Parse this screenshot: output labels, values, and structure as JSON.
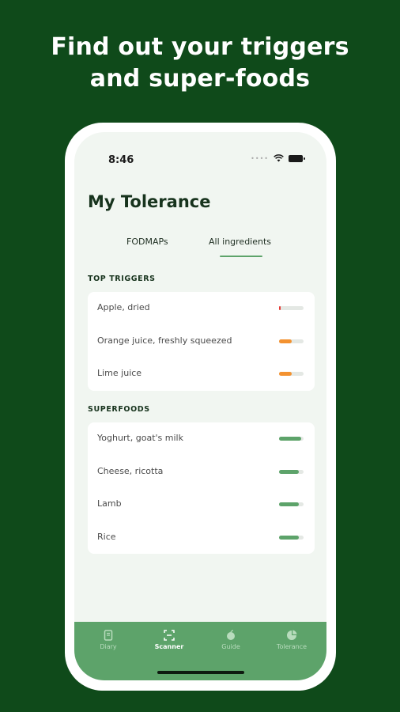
{
  "headline": {
    "line1": "Find out your triggers",
    "line2": "and super-foods"
  },
  "status_bar": {
    "time": "8:46"
  },
  "page": {
    "title": "My Tolerance"
  },
  "tabs": [
    {
      "label": "FODMAPs",
      "active": false
    },
    {
      "label": "All ingredients",
      "active": true
    }
  ],
  "top_triggers": {
    "label": "TOP TRIGGERS",
    "items": [
      {
        "name": "Apple, dried",
        "level": 0.05,
        "color": "#e53935"
      },
      {
        "name": "Orange juice, freshly squeezed",
        "level": 0.5,
        "color": "#f39230"
      },
      {
        "name": "Lime juice",
        "level": 0.5,
        "color": "#f39230"
      }
    ]
  },
  "superfoods": {
    "label": "SUPERFOODS",
    "items": [
      {
        "name": "Yoghurt, goat's milk",
        "level": 0.9,
        "color": "#5da36a"
      },
      {
        "name": "Cheese, ricotta",
        "level": 0.8,
        "color": "#5da36a"
      },
      {
        "name": "Lamb",
        "level": 0.8,
        "color": "#5da36a"
      },
      {
        "name": "Rice",
        "level": 0.8,
        "color": "#5da36a"
      }
    ]
  },
  "bottom_nav": [
    {
      "label": "Diary",
      "icon": "diary-icon",
      "active": false
    },
    {
      "label": "Scanner",
      "icon": "scanner-icon",
      "active": true
    },
    {
      "label": "Guide",
      "icon": "apple-icon",
      "active": false
    },
    {
      "label": "Tolerance",
      "icon": "pie-chart-icon",
      "active": false
    }
  ],
  "colors": {
    "background": "#0f4a1a",
    "accent": "#5da36a",
    "trigger_red": "#e53935",
    "trigger_orange": "#f39230"
  }
}
